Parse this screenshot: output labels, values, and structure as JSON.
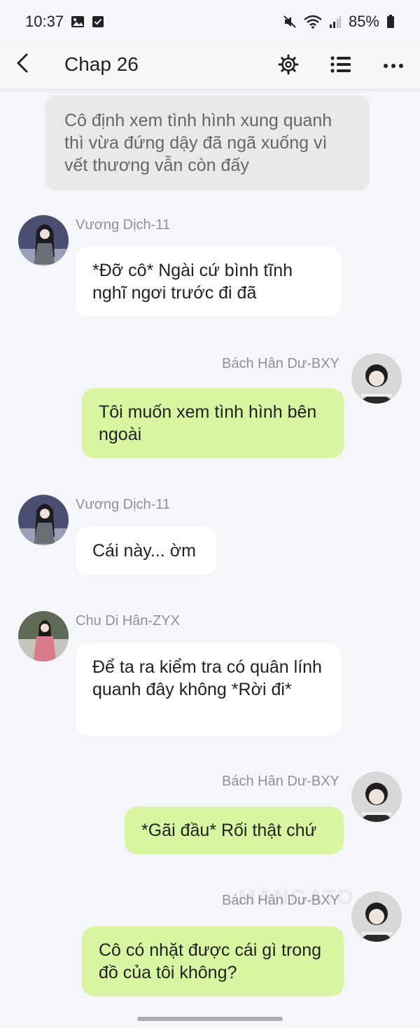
{
  "status_bar": {
    "time": "10:37",
    "battery": "85%",
    "icons": [
      "gallery-icon",
      "check-box-icon",
      "mute-icon",
      "wifi-icon",
      "signal-icon",
      "battery-icon"
    ]
  },
  "app_bar": {
    "title": "Chap 26",
    "icons": [
      "back-icon",
      "gear-icon",
      "list-icon",
      "more-icon"
    ]
  },
  "narration": "Cô định xem tình hình xung quanh thì vừa đứng dậy đã ngã xuống vì vết thương vẫn còn đấy",
  "messages": [
    {
      "sender": "Vương Dịch-11",
      "side": "left",
      "text": "*Đỡ cô* Ngài cứ bình tĩnh nghĩ ngơi trước đi đã"
    },
    {
      "sender": "Bách Hân Dư-BXY",
      "side": "right",
      "text": "Tôi muốn xem tình hình bên ngoài"
    },
    {
      "sender": "Vương Dịch-11",
      "side": "left",
      "text": "Cái này... ờm"
    },
    {
      "sender": "Chu Di Hân-ZYX",
      "side": "left",
      "text": "Để ta ra kiểm tra có quân lính quanh đây không *Rời đi*"
    },
    {
      "sender": "Bách Hân Dư-BXY",
      "side": "right",
      "text": "*Gãi đầu* Rối thật chứ"
    },
    {
      "sender": "Bách Hân Dư-BXY",
      "side": "right",
      "text": "Cô có nhặt được cái gì trong đồ của tôi không?"
    }
  ],
  "watermark": "MANGATO",
  "colors": {
    "background": "#f4f6f9",
    "bubble_left": "#ffffff",
    "bubble_right": "#d8f5a2",
    "narration_bg": "#e8e9eb",
    "sender_name": "#8e9196"
  }
}
